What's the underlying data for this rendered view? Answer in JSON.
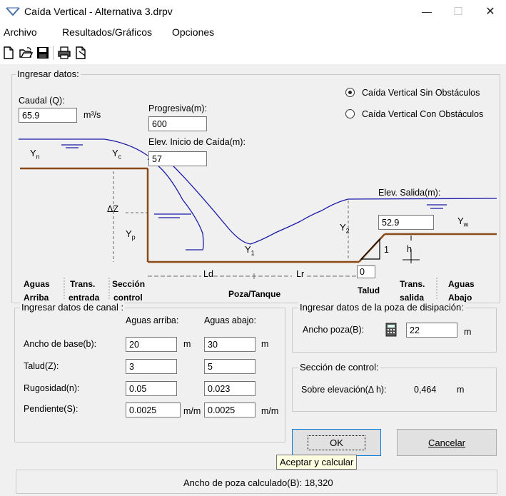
{
  "window": {
    "title": "Caída Vertical - Alternativa 3.drpv",
    "minimize": "—",
    "maximize": "☐",
    "close": "✕"
  },
  "menu": [
    "Archivo",
    "Resultados/Gráficos",
    "Opciones"
  ],
  "toolbar": [
    "new-file-icon",
    "open-folder-icon",
    "save-icon",
    "print-icon",
    "print-preview-icon"
  ],
  "input_group": {
    "label": "Ingresar datos:",
    "caudal_label": "Caudal (Q):",
    "caudal_value": "65.9",
    "caudal_unit": "m³/s",
    "progresiva_label": "Progresiva(m):",
    "progresiva_value": "600",
    "elev_inicio_label": "Elev. Inicio de Caída(m):",
    "elev_inicio_value": "57",
    "elev_salida_label": "Elev. Salida(m):",
    "elev_salida_value": "52.9",
    "talud_value": "0",
    "radio_sin": "Caída Vertical Sin Obstáculos",
    "radio_con": "Caída Vertical Con Obstáculos",
    "selected_radio": "sin"
  },
  "diagram": {
    "yn": "Y",
    "yn_sub": "n",
    "yc": "Y",
    "yc_sub": "c",
    "dz": "ΔZ",
    "yp": "Y",
    "yp_sub": "p",
    "y1": "Y",
    "y1_sub": "1",
    "y2": "Y",
    "y2_sub": "2",
    "yw": "Y",
    "yw_sub": "w",
    "ld": "Ld",
    "lr": "Lr",
    "h": "h",
    "one": "1",
    "labels": {
      "aguas_arriba_1": "Aguas",
      "aguas_arriba_2": "Arriba",
      "trans_entrada_1": "Trans.",
      "trans_entrada_2": "entrada",
      "seccion_control_1": "Sección",
      "seccion_control_2": "control",
      "poza": "Poza/Tanque",
      "talud": "Talud",
      "trans_salida_1": "Trans.",
      "trans_salida_2": "salida",
      "aguas_abajo_1": "Aguas",
      "aguas_abajo_2": "Abajo"
    }
  },
  "canal_group": {
    "label": "Ingresar datos de canal :",
    "col_arriba": "Aguas arriba:",
    "col_abajo": "Aguas abajo:",
    "rows": [
      {
        "label": "Ancho de base(b):",
        "arriba": "20",
        "unit1": "m",
        "abajo": "30",
        "unit2": "m"
      },
      {
        "label": "Talud(Z):",
        "arriba": "3",
        "unit1": "",
        "abajo": "5",
        "unit2": ""
      },
      {
        "label": "Rugosidad(n):",
        "arriba": "0.05",
        "unit1": "",
        "abajo": "0.023",
        "unit2": ""
      },
      {
        "label": "Pendiente(S):",
        "arriba": "0.0025",
        "unit1": "m/m",
        "abajo": "0.0025",
        "unit2": "m/m"
      }
    ]
  },
  "poza_group": {
    "label": "Ingresar datos de la poza de disipación:",
    "ancho_label": "Ancho poza(B):",
    "ancho_value": "22",
    "unit": "m"
  },
  "control_group": {
    "label": "Sección de control:",
    "sobre_label": "Sobre elevación(Δ h):",
    "sobre_value": "0,464",
    "unit": "m"
  },
  "buttons": {
    "ok": "OK",
    "cancel": "Cancelar"
  },
  "tooltip": "Aceptar y calcular",
  "status": "Ancho de poza calculado(B): 18,320"
}
